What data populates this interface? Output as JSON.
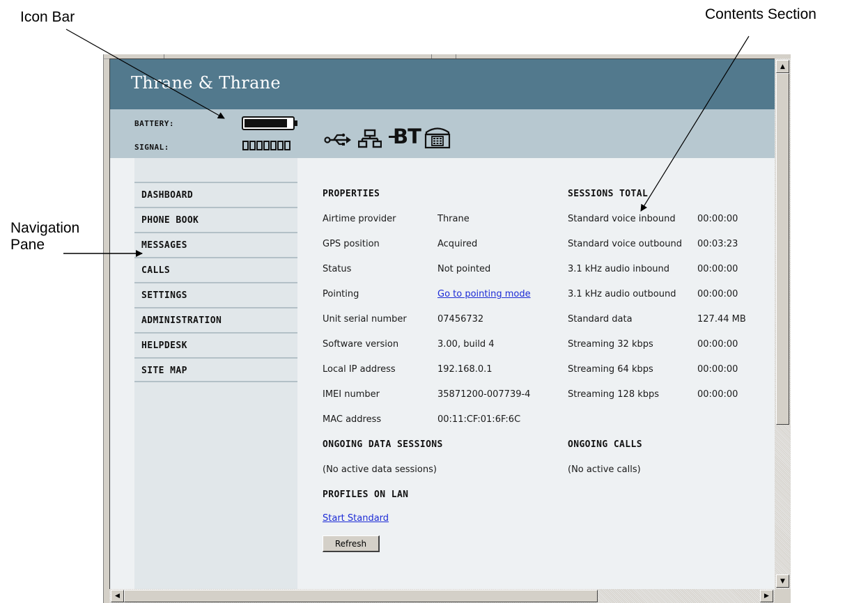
{
  "callouts": {
    "icon_bar": "Icon Bar",
    "contents_section": "Contents Section",
    "navigation_pane_line1": "Navigation",
    "navigation_pane_line2": "Pane"
  },
  "header": {
    "brand": "Thrane & Thrane",
    "battery_label": "BATTERY:",
    "signal_label": "SIGNAL:",
    "battery_level": 0.95,
    "signal_bars_total": 7,
    "device_icons": [
      "usb-icon",
      "lan-icon",
      "bluetooth-icon",
      "phone-icon"
    ],
    "bt_text": "BT"
  },
  "nav": {
    "items": [
      {
        "label": "DASHBOARD"
      },
      {
        "label": "PHONE BOOK"
      },
      {
        "label": "MESSAGES"
      },
      {
        "label": "CALLS"
      },
      {
        "label": "SETTINGS"
      },
      {
        "label": "ADMINISTRATION"
      },
      {
        "label": "HELPDESK"
      },
      {
        "label": "SITE MAP"
      }
    ]
  },
  "properties": {
    "title": "PROPERTIES",
    "rows": [
      {
        "label": "Airtime provider",
        "value": "Thrane"
      },
      {
        "label": "GPS position",
        "value": "Acquired"
      },
      {
        "label": "Status",
        "value": "Not pointed"
      },
      {
        "label": "Pointing",
        "value": "Go to pointing mode"
      },
      {
        "label": "Unit serial number",
        "value": "07456732"
      },
      {
        "label": "Software version",
        "value": "3.00, build 4"
      },
      {
        "label": "Local IP address",
        "value": "192.168.0.1"
      },
      {
        "label": "IMEI number",
        "value": "35871200-007739-4"
      },
      {
        "label": "MAC address",
        "value": "00:11:CF:01:6F:6C"
      }
    ]
  },
  "sessions_total": {
    "title": "SESSIONS TOTAL",
    "rows": [
      {
        "label": "Standard voice inbound",
        "value": "00:00:00"
      },
      {
        "label": "Standard voice outbound",
        "value": "00:03:23"
      },
      {
        "label": "3.1 kHz audio inbound",
        "value": "00:00:00"
      },
      {
        "label": "3.1 kHz audio outbound",
        "value": "00:00:00"
      },
      {
        "label": "Standard data",
        "value": "127.44 MB"
      },
      {
        "label": "Streaming 32 kbps",
        "value": "00:00:00"
      },
      {
        "label": "Streaming 64 kbps",
        "value": "00:00:00"
      },
      {
        "label": "Streaming 128 kbps",
        "value": "00:00:00"
      }
    ]
  },
  "ongoing_data": {
    "title": "ONGOING DATA SESSIONS",
    "text": "(No active data sessions)"
  },
  "ongoing_calls": {
    "title": "ONGOING CALLS",
    "text": "(No active calls)"
  },
  "profiles": {
    "title": "PROFILES ON LAN",
    "link": "Start Standard"
  },
  "refresh_label": "Refresh",
  "colors": {
    "brand_bar": "#52798d",
    "icon_bar": "#b7c8d0",
    "content_bg": "#eef1f3",
    "nav_bg": "#e1e7ea",
    "link": "#1c2bd6"
  }
}
